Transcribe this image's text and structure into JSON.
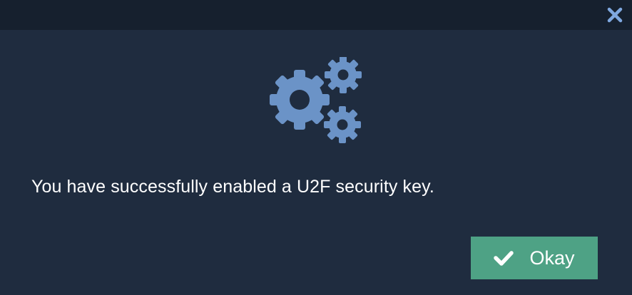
{
  "dialog": {
    "close_icon": "close-icon",
    "illustration_icon": "gears-icon",
    "message": "You have successfully enabled a U2F security key.",
    "okay_button": {
      "label": "Okay",
      "icon": "checkmark-icon"
    }
  },
  "colors": {
    "background": "#1f2c3f",
    "titlebar": "#16202e",
    "accent_icon": "#6b93c7",
    "close_icon": "#7fa8e0",
    "button": "#4ea285",
    "text": "#ffffff"
  }
}
